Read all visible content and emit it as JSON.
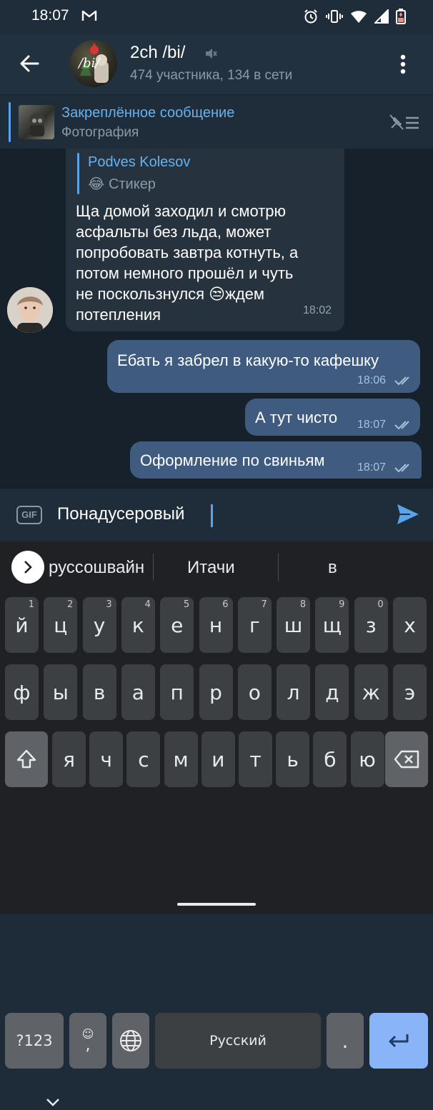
{
  "status_bar": {
    "time": "18:07"
  },
  "header": {
    "title": "2ch /bi/",
    "subtitle": "474 участника, 134 в сети",
    "avatar_text": "/bi/"
  },
  "pinned": {
    "title": "Закреплённое сообщение",
    "subtitle": "Фотография"
  },
  "messages": [
    {
      "direction": "in",
      "reply_author": "Podves Kolesov",
      "reply_emoji": "😂",
      "reply_text": "Стикер",
      "lines": [
        "Ща домой заходил и смотрю",
        "асфальты без льда, может",
        "попробовать завтра котнуть, а",
        "потом немного прошёл и чуть",
        "не поскользнулся 😒ждем",
        "потепления"
      ],
      "time": "18:02"
    },
    {
      "direction": "out",
      "text": "Ебать я забрел в какую-то кафешку",
      "time": "18:06"
    },
    {
      "direction": "out",
      "text": "А тут чисто",
      "time": "18:07"
    },
    {
      "direction": "out",
      "text": "Оформление по свиньям",
      "time": "18:07"
    }
  ],
  "input": {
    "gif_label": "GIF",
    "value": "Понадусеровый"
  },
  "keyboard": {
    "suggestions": [
      "руссошвайн",
      "Итачи",
      "в"
    ],
    "row1": [
      {
        "k": "й",
        "h": "1"
      },
      {
        "k": "ц",
        "h": "2"
      },
      {
        "k": "у",
        "h": "3"
      },
      {
        "k": "к",
        "h": "4"
      },
      {
        "k": "е",
        "h": "5"
      },
      {
        "k": "н",
        "h": "6"
      },
      {
        "k": "г",
        "h": "7"
      },
      {
        "k": "ш",
        "h": "8"
      },
      {
        "k": "щ",
        "h": "9"
      },
      {
        "k": "з",
        "h": "0"
      },
      {
        "k": "х",
        "h": ""
      }
    ],
    "row2": [
      "ф",
      "ы",
      "в",
      "а",
      "п",
      "р",
      "о",
      "л",
      "д",
      "ж",
      "э"
    ],
    "row3": [
      "я",
      "ч",
      "с",
      "м",
      "и",
      "т",
      "ь",
      "б",
      "ю"
    ],
    "symbols_label": "?123",
    "comma_label": ",",
    "space_label": "Русский",
    "period_label": "."
  },
  "colors": {
    "accent": "#5aa3e8",
    "outgoing_bubble": "#3f5c80",
    "incoming_bubble": "#26323e",
    "chat_background": "#17212b"
  }
}
